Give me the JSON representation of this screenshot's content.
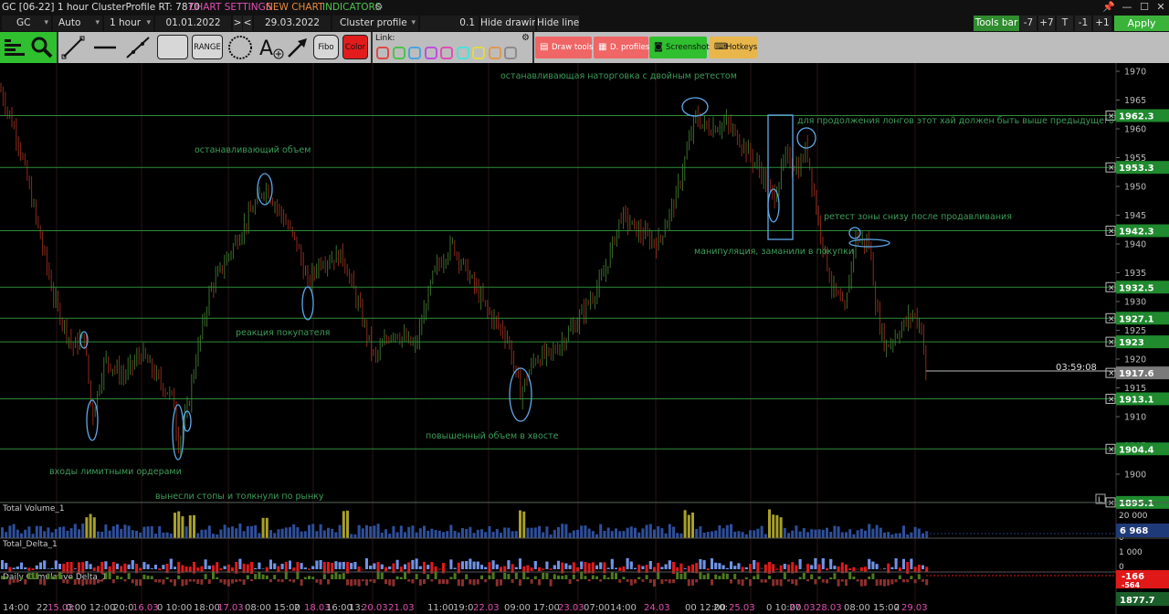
{
  "titlebar": {
    "title": "GC [06-22] 1 hour ClusterProfile RT: 7870",
    "chart_settings": "CHART SETTINGS",
    "new_chart": "NEW CHART",
    "indicators": "INDICATORS",
    "pin": "📌",
    "minimize": "—",
    "maximize": "☐",
    "close": "✕"
  },
  "controls": {
    "symbol": "GC",
    "scale_mode": "Auto",
    "timeframe": "1 hour",
    "date_from": "01.01.2022",
    "next": ">",
    "prev": "<",
    "date_to": "29.03.2022",
    "profile_type": "Cluster profile",
    "tick_size": "0.1",
    "hide_drawing": "Hide drawing",
    "hide_lines": "Hide lines",
    "tools_bar": "Tools bar",
    "minus7": "-7",
    "plus7": "+7",
    "t": "T",
    "minus1": "-1",
    "plus1": "+1",
    "apply": "Apply"
  },
  "toolbar": {
    "range": "RANGE",
    "fibo": "Fibo",
    "color": "Color",
    "link_label": "Link:",
    "link_colors": [
      "#e04848",
      "#4ec24e",
      "#4aa3e0",
      "#c04ee0",
      "#e04fb3",
      "#4ee0d8",
      "#e0d84e",
      "#e09a4e",
      "#8c8c8c"
    ],
    "draw_tools": "Draw tools",
    "d_profiles": "D. profiles",
    "screenshot": "Screenshot",
    "hotkeys": "Hotkeys"
  },
  "chart": {
    "y_ticks": [
      "1970",
      "1965",
      "1960",
      "1955",
      "1950",
      "1945",
      "1940",
      "1935",
      "1930",
      "1925",
      "1920",
      "1915",
      "1910",
      "1905",
      "1900"
    ],
    "price_lines": [
      {
        "label": "1962.3",
        "color": "#2e8c3a"
      },
      {
        "label": "1953.3",
        "color": "#2e8c3a"
      },
      {
        "label": "1942.3",
        "color": "#2e8c3a"
      },
      {
        "label": "1932.5",
        "color": "#2e8c3a"
      },
      {
        "label": "1927.1",
        "color": "#2e8c3a"
      },
      {
        "label": "1923",
        "color": "#2e8c3a"
      },
      {
        "label": "1917.6",
        "color": "#8a8a8a"
      },
      {
        "label": "1913.1",
        "color": "#2e8c3a"
      },
      {
        "label": "1904.4",
        "color": "#2e8c3a"
      },
      {
        "label": "1895.1",
        "color": "#2e8c3a"
      }
    ],
    "timer": "03:59:08",
    "close_mark": "✕",
    "lock_L": "L",
    "annotations": {
      "double_retest": "останавливающая наторговка с двойным ретестом",
      "longs_high": "для продолжения лонгов этот хай должен быть выше предыдущего",
      "stopping_volume": "останавливающий объем",
      "retest_zone": "ретест зоны снизу после продавливания",
      "manipulation": "манипуляция, заманили в покупки",
      "buyer_reaction": "реакция покупателя",
      "high_volume_tail": "повышенный объем в хвосте",
      "limit_entries": "входы лимитными ордерами",
      "stops_out": "вынесли стопы и толкнули по рынку"
    },
    "panels": {
      "total_volume": {
        "label": "Total Volume_1",
        "tick": "20 000",
        "zero": "0",
        "value": "6 968",
        "value_color": "#1f3a78"
      },
      "total_delta": {
        "label": "Total_Delta_1",
        "tick": "1 000",
        "zero": "0"
      },
      "cum_delta": {
        "label": "Daily Cumulative Delta_1",
        "value1": "-166",
        "value2": "-564",
        "value3": "1877.7"
      }
    },
    "x_labels": [
      {
        "text": "14:00",
        "type": "time"
      },
      {
        "text": "22",
        "type": "time"
      },
      {
        "text": "15.03",
        "type": "date"
      },
      {
        "text": "0:00 12:00",
        "type": "time"
      },
      {
        "text": "20:0",
        "type": "time"
      },
      {
        "text": "16.03",
        "type": "date"
      },
      {
        "text": "0 10:00",
        "type": "time"
      },
      {
        "text": "18:00",
        "type": "time"
      },
      {
        "text": "17.03",
        "type": "date"
      },
      {
        "text": "08:00 15:00",
        "type": "time"
      },
      {
        "text": "2",
        "type": "time"
      },
      {
        "text": "18.03",
        "type": "date"
      },
      {
        "text": "16:00",
        "type": "time"
      },
      {
        "text": "13:",
        "type": "time"
      },
      {
        "text": "20.03",
        "type": "date"
      },
      {
        "text": "21.03",
        "type": "date"
      },
      {
        "text": "11:00",
        "type": "time"
      },
      {
        "text": "19:0",
        "type": "time"
      },
      {
        "text": "22.03",
        "type": "date"
      },
      {
        "text": "09:00 17:00",
        "type": "time"
      },
      {
        "text": "23.03",
        "type": "date"
      },
      {
        "text": "07:00",
        "type": "time"
      },
      {
        "text": "14:00",
        "type": "time"
      },
      {
        "text": "24.03",
        "type": "date"
      },
      {
        "text": "00 12:00",
        "type": "time"
      },
      {
        "text": "20:",
        "type": "time"
      },
      {
        "text": "25.03",
        "type": "date"
      },
      {
        "text": "0 10:00",
        "type": "time"
      },
      {
        "text": "27.03",
        "type": "date"
      },
      {
        "text": "28.03",
        "type": "date"
      },
      {
        "text": "08:00 15:00",
        "type": "time"
      },
      {
        "text": "2",
        "type": "time"
      },
      {
        "text": "29.03",
        "type": "date"
      }
    ]
  }
}
